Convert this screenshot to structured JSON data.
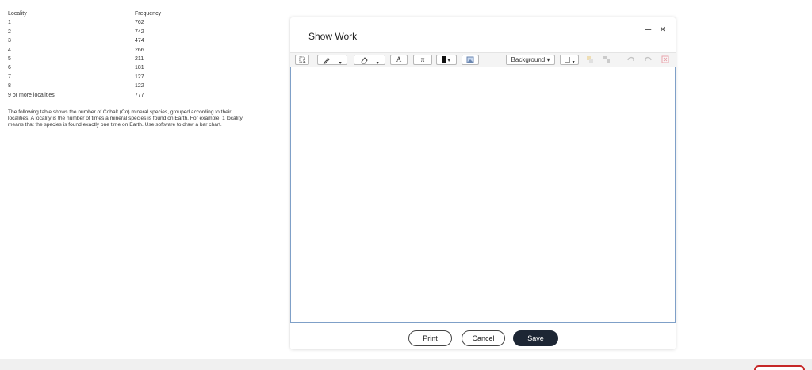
{
  "table": {
    "headers": [
      "Locality",
      "Frequency"
    ],
    "rows": [
      [
        "1",
        "762"
      ],
      [
        "2",
        "742"
      ],
      [
        "3",
        "474"
      ],
      [
        "4",
        "266"
      ],
      [
        "5",
        "211"
      ],
      [
        "6",
        "181"
      ],
      [
        "7",
        "127"
      ],
      [
        "8",
        "122"
      ],
      [
        "9 or more localities",
        "777"
      ]
    ]
  },
  "problem_text": "The following table shows the number of Cobalt (Co) mineral species, grouped according to their localities. A locality is the number of times a mineral species is found on Earth. For example, 1 locality means that the species is found exactly one time on Earth. Use software to draw a bar chart.",
  "dialog": {
    "title": "Show Work",
    "minimize_glyph": "–",
    "close_glyph": "×",
    "toolbar": {
      "text_tool": "A",
      "pi_tool": "π",
      "background_label": "Background ▾",
      "dropdown_glyph": "▾"
    },
    "buttons": {
      "print": "Print",
      "cancel": "Cancel",
      "save": "Save"
    }
  },
  "colors": {
    "save_button": "#1d2634",
    "canvas_border": "#7fa0c8",
    "footer_button_border": "#c62828"
  }
}
